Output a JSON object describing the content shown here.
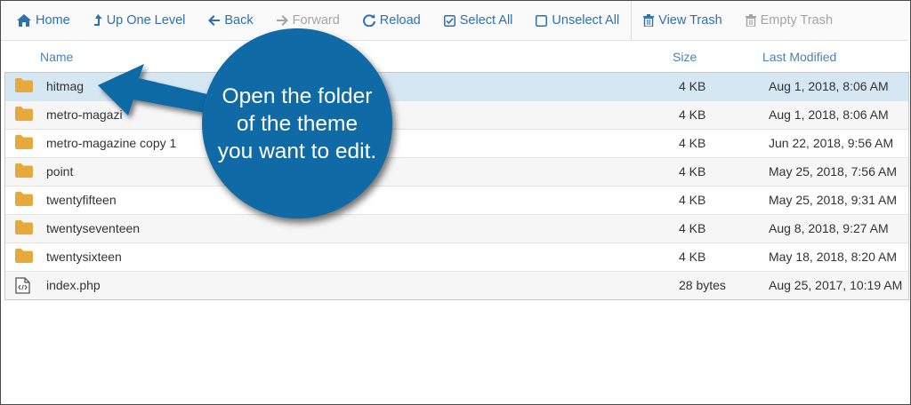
{
  "toolbar": {
    "home": "Home",
    "up": "Up One Level",
    "back": "Back",
    "forward": "Forward",
    "reload": "Reload",
    "select_all": "Select All",
    "unselect_all": "Unselect All",
    "view_trash": "View Trash",
    "empty_trash": "Empty Trash"
  },
  "table": {
    "headers": {
      "name": "Name",
      "size": "Size",
      "modified": "Last Modified"
    },
    "rows": [
      {
        "name": "hitmag",
        "size": "4 KB",
        "modified": "Aug 1, 2018, 8:06 AM",
        "icon": "folder-icon",
        "selected": true
      },
      {
        "name": "metro-magazi",
        "size": "4 KB",
        "modified": "Aug 1, 2018, 8:06 AM",
        "icon": "folder-icon"
      },
      {
        "name": "metro-magazine copy 1",
        "size": "4 KB",
        "modified": "Jun 22, 2018, 9:56 AM",
        "icon": "folder-icon"
      },
      {
        "name": "point",
        "size": "4 KB",
        "modified": "May 25, 2018, 7:56 AM",
        "icon": "folder-icon"
      },
      {
        "name": "twentyfifteen",
        "size": "4 KB",
        "modified": "May 25, 2018, 9:31 AM",
        "icon": "folder-icon"
      },
      {
        "name": "twentyseventeen",
        "size": "4 KB",
        "modified": "Aug 8, 2018, 9:27 AM",
        "icon": "folder-icon"
      },
      {
        "name": "twentysixteen",
        "size": "4 KB",
        "modified": "May 18, 2018, 8:20 AM",
        "icon": "folder-icon"
      },
      {
        "name": "index.php",
        "size": "28 bytes",
        "modified": "Aug 25, 2017, 10:19 AM",
        "icon": "php-file-icon"
      }
    ]
  },
  "callout": {
    "line1": "Open the folder",
    "line2": "of the theme",
    "line3": "you want to edit."
  },
  "colors": {
    "link": "#2f6fae",
    "callout": "#0f6aa5",
    "folder": "#e5a93c",
    "selected_row": "#d6e7f4"
  }
}
